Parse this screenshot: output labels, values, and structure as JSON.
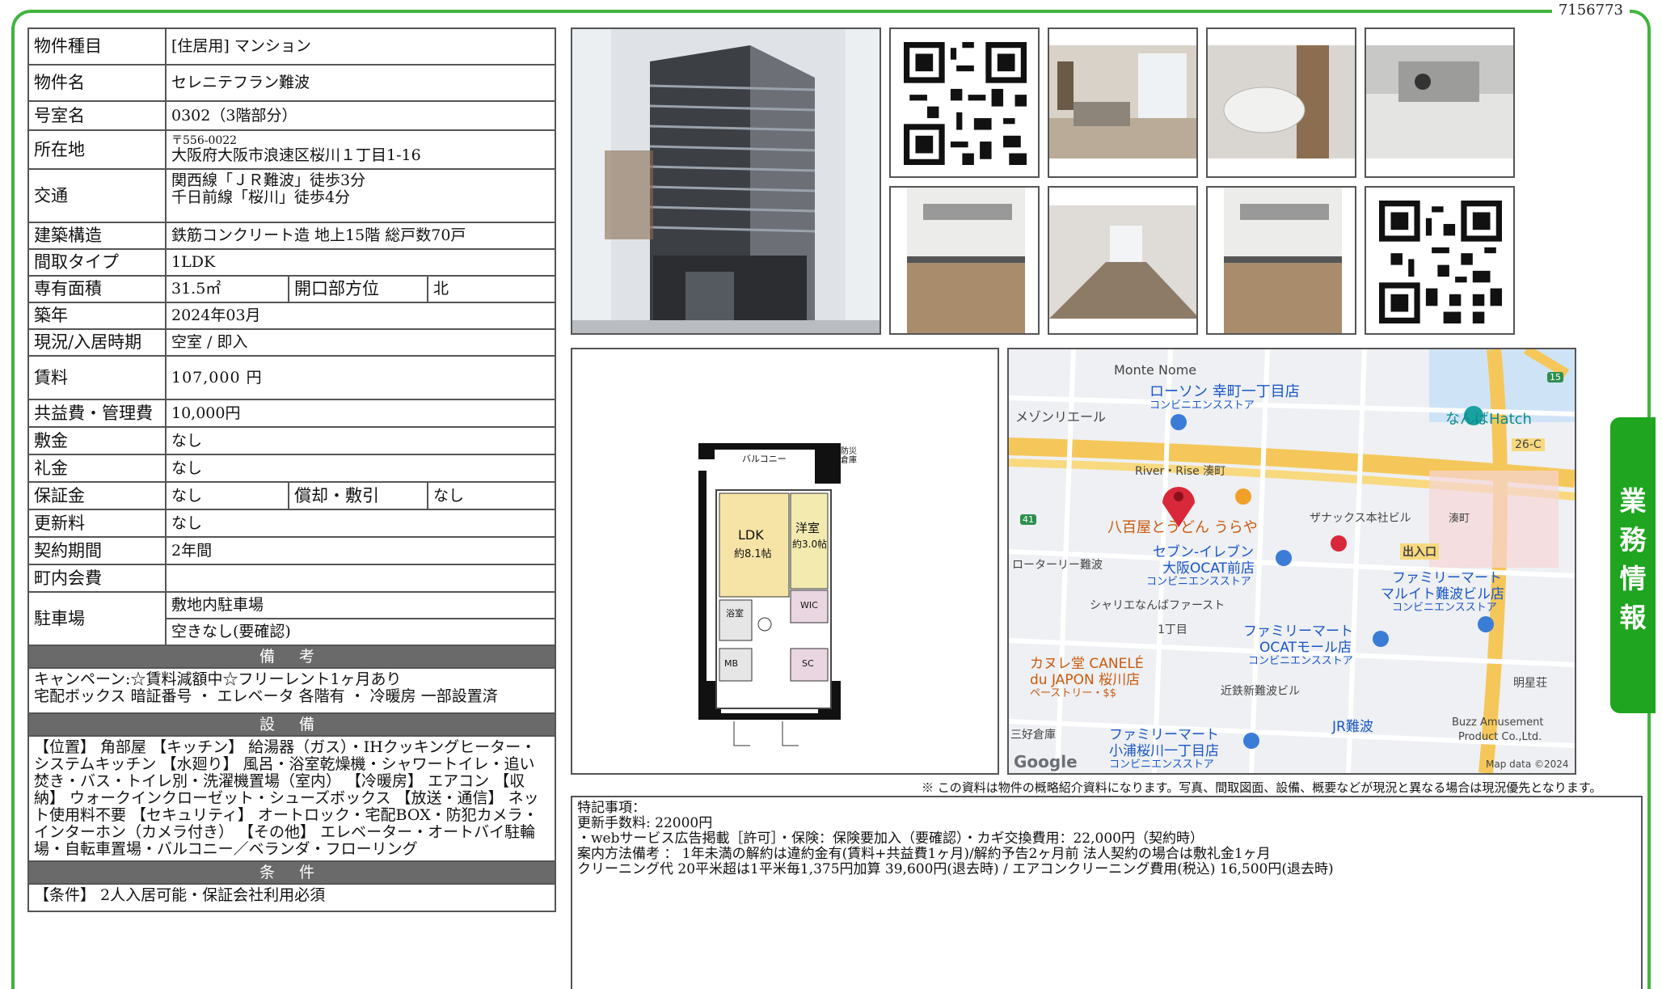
{
  "doc_id": "7156773",
  "side_tab": [
    "業",
    "務",
    "情",
    "報"
  ],
  "spec": {
    "type_label": "物件種目",
    "type_value": "[住居用] マンション",
    "name_label": "物件名",
    "name_value": "セレニテフラン難波",
    "room_label": "号室名",
    "room_value": "0302（3階部分）",
    "address_label": "所在地",
    "postal": "〒556-0022",
    "address": "大阪府大阪市浪速区桜川１丁目1-16",
    "traffic_label": "交通",
    "traffic_1": "関西線「ＪＲ難波」徒歩3分",
    "traffic_2": "千日前線「桜川」徒歩4分",
    "structure_label": "建築構造",
    "structure_value": "鉄筋コンクリート造 地上15階 総戸数70戸",
    "layout_label": "間取タイプ",
    "layout_value": "1LDK",
    "area_label": "専有面積",
    "area_value": "31.5㎡",
    "direction_label": "開口部方位",
    "direction_value": "北",
    "built_label": "築年",
    "built_value": "2024年03月",
    "status_label": "現況/入居時期",
    "status_value": "空室 / 即入",
    "rent_label": "賃料",
    "rent_value": "107,000 円",
    "fee_label": "共益費・管理費",
    "fee_value": "10,000円",
    "deposit_label": "敷金",
    "deposit_value": "なし",
    "key_money_label": "礼金",
    "key_money_value": "なし",
    "guarantee_label": "保証金",
    "guarantee_value": "なし",
    "amort_label": "償却・敷引",
    "amort_value": "なし",
    "renewal_label": "更新料",
    "renewal_value": "なし",
    "contract_label": "契約期間",
    "contract_value": "2年間",
    "town_fee_label": "町内会費",
    "town_fee_value": "",
    "parking_label": "駐車場",
    "parking_1": "敷地内駐車場",
    "parking_2": "空きなし(要確認)",
    "remarks_title": "備 考",
    "remarks_1": "キャンペーン:☆賃料減額中☆フリーレント1ヶ月あり",
    "remarks_2": "宅配ボックス 暗証番号 ・ エレベータ 各階有 ・ 冷暖房 一部設置済",
    "equip_title": "設 備",
    "equip_text": "【位置】 角部屋 【キッチン】 給湯器（ガス）・IHクッキングヒーター・システムキッチン 【水廻り】 風呂・浴室乾燥機・シャワートイレ・追い焚き・バス・トイレ別・洗濯機置場（室内） 【冷暖房】 エアコン 【収納】 ウォークインクローゼット・シューズボックス 【放送・通信】 ネット使用料不要 【セキュリティ】 オートロック・宅配BOX・防犯カメラ・インターホン（カメラ付き） 【その他】 エレベーター・オートバイ駐輪場・自転車置場・バルコニー／ベランダ・フローリング",
    "cond_title": "条 件",
    "cond_text": "【条件】 2人入居可能・保証会社利用必須"
  },
  "floorplan": {
    "balcony": "バルコニー",
    "ldk": "LDK",
    "ldk_size": "約8.1帖",
    "western": "洋室",
    "western_size": "約3.0帖",
    "wic": "WIC",
    "bath": "浴室",
    "sc": "SC",
    "mb": "MB",
    "storage": "防災倉庫"
  },
  "map": {
    "labels": [
      "Monte Nome",
      "ローソン 幸町一丁目店",
      "コンビニエンスストア",
      "メゾンリエール",
      "なんばHatch",
      "River・Rise 湊町",
      "26-C",
      "八百屋とうどん うらや",
      "ザナックス本社ビル",
      "湊町",
      "出入口",
      "セブン-イレブン",
      "大阪OCAT前店",
      "コンビニエンスストア",
      "ローターリー難波",
      "ファミリーマート",
      "マルイト難波ビル店",
      "コンビニエンスストア",
      "シャリエなんばファースト",
      "1丁目",
      "ファミリーマート",
      "OCATモール店",
      "コンビニエンスストア",
      "カヌレ堂 CANELÉ",
      "du JAPON 桜川店",
      "ペーストリー・$$",
      "近鉄新難波ビル",
      "明星荘",
      "JR難波",
      "三好倉庫",
      "ファミリーマート",
      "小浦桜川一丁目店",
      "コンビニエンスストア",
      "Buzz Amusement",
      "Product Co.,Ltd.",
      "Google",
      "Map data ©2024",
      "15",
      "41"
    ]
  },
  "disclaimer": "※ この資料は物件の概略紹介資料になります。写真、間取図面、設備、概要などが現況と異なる場合は現況優先となります。",
  "special": {
    "title": "特記事項：",
    "line1": "更新手数料: 22000円",
    "line2": "・webサービス広告掲載［許可］・保険：保険要加入（要確認）・カギ交換費用：22,000円（契約時）",
    "line3": "案内方法備考 ： 1年未満の解約は違約金有(賃料+共益費1ヶ月)/解約予告2ヶ月前 法人契約の場合は敷礼金1ヶ月",
    "line4": "クリーニング代 20平米超は1平米毎1,375円加算 39,600円(退去時) / エアコンクリーニング費用(税込) 16,500円(退去時)"
  },
  "colors": {
    "frame": "#3fb43f",
    "tab": "#1fa51f",
    "section": "#6a6a6a",
    "map_pin": "#d8283a"
  }
}
